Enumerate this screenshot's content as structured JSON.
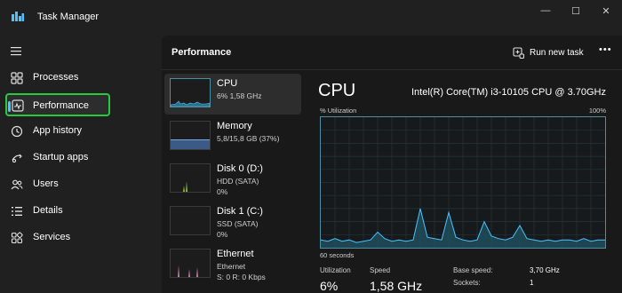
{
  "window": {
    "title": "Task Manager",
    "controls": {
      "minimize": "—",
      "maximize": "☐",
      "close": "✕"
    }
  },
  "sidebar": {
    "menu_icon": "hamburger-icon",
    "items": [
      {
        "label": "Processes",
        "icon": "processes-icon",
        "active": false
      },
      {
        "label": "Performance",
        "icon": "performance-icon",
        "active": true
      },
      {
        "label": "App history",
        "icon": "history-icon",
        "active": false
      },
      {
        "label": "Startup apps",
        "icon": "startup-icon",
        "active": false
      },
      {
        "label": "Users",
        "icon": "users-icon",
        "active": false
      },
      {
        "label": "Details",
        "icon": "details-icon",
        "active": false
      },
      {
        "label": "Services",
        "icon": "services-icon",
        "active": false
      }
    ]
  },
  "header": {
    "title": "Performance",
    "run_task_label": "Run new task",
    "more_label": "•••"
  },
  "devices": [
    {
      "name": "CPU",
      "sub1": "6%  1,58 GHz",
      "sub2": "",
      "selected": true
    },
    {
      "name": "Memory",
      "sub1": "5,8/15,8 GB (37%)",
      "sub2": "",
      "selected": false
    },
    {
      "name": "Disk 0 (D:)",
      "sub1": "HDD (SATA)",
      "sub2": "0%",
      "selected": false
    },
    {
      "name": "Disk 1 (C:)",
      "sub1": "SSD (SATA)",
      "sub2": "0%",
      "selected": false
    },
    {
      "name": "Ethernet",
      "sub1": "Ethernet",
      "sub2": "S: 0  R: 0 Kbps",
      "selected": false
    }
  ],
  "detail": {
    "title": "CPU",
    "model": "Intel(R) Core(TM) i3-10105 CPU @ 3.70GHz",
    "util_label": "% Utilization",
    "util_max": "100%",
    "time_label": "60 seconds",
    "stats": {
      "utilization_label": "Utilization",
      "utilization_value": "6%",
      "speed_label": "Speed",
      "speed_value": "1,58 GHz"
    },
    "specs": {
      "base_speed_label": "Base speed:",
      "base_speed_value": "3,70 GHz",
      "sockets_label": "Sockets:",
      "sockets_value": "1"
    }
  },
  "colors": {
    "accent_green": "#27c93f",
    "accent_blue": "#4cc2ff",
    "graph_line": "#4e8ea3",
    "memory_fill": "#5a7fb3",
    "disk_fill": "#8fbf3f",
    "ethernet_fill": "#c97fb0"
  },
  "graph_series": {
    "cpu_utilization_percent": [
      6,
      5,
      7,
      5,
      6,
      4,
      5,
      6,
      12,
      7,
      5,
      6,
      5,
      6,
      30,
      8,
      7,
      6,
      27,
      8,
      6,
      5,
      6,
      20,
      9,
      7,
      6,
      8,
      17,
      7,
      6,
      5,
      6,
      5,
      6,
      6,
      5,
      7,
      5,
      6,
      6
    ]
  }
}
